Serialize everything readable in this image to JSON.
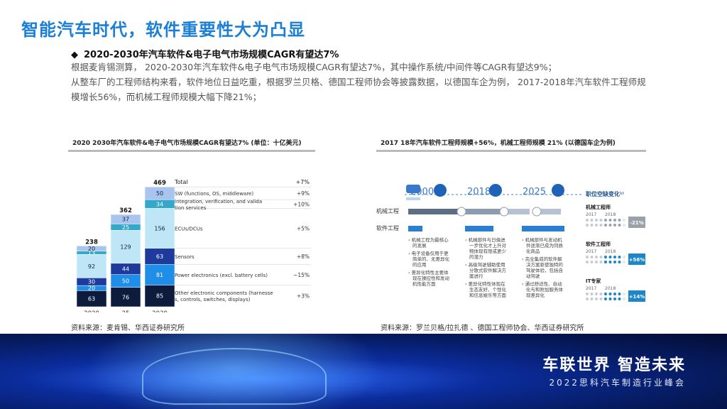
{
  "header": {
    "title": "智能汽车时代，软件重要性大为凸显",
    "bullet": "2020-2030年汽车软件&电子电气市场规模CAGR有望达7%",
    "para1": "根据麦肯锡测算， 2020-2030年汽车软件&电子电气市场规模CAGR有望达7%，其中操作系统/中间件等CAGR有望达9%；",
    "para2": "从整车厂的工程师结构来看，软件地位日益吃重，根据罗兰贝格、德国工程师协会等披露数据，以德国车企为例， 2017-2018年汽车软件工程师规模增长56%，而机械工程师规模大幅下降21%；"
  },
  "left_card": {
    "title": "2020 2030年汽车软件&电子电气市场规模CAGR有望达7% (单位：十亿美元)",
    "source": "资料来源：麦肯锡、华西证券研究所",
    "col_header_total": "Total",
    "col_header_cagr": "+7%"
  },
  "right_card": {
    "title": "2017 18年汽车软件工程师规模+56%，机械工程师规模 21% (以德国车企为例)",
    "source": "资料来源：罗兰贝格/拉扎德 、德国工程师协会、华西证券研究所",
    "years": [
      "2000",
      "2018",
      "2025"
    ],
    "row_mech": "机械工程",
    "row_soft": "软件工程",
    "panel_title": "职位空缺变化¹⁾",
    "groups": [
      {
        "label": "机械工程师",
        "y1": "2017",
        "y2": "2018",
        "change": "-21%",
        "color": "#9aa1ab"
      },
      {
        "label": "软件工程师",
        "y1": "2017",
        "y2": "2018",
        "change": "+56%",
        "color": "#1c86c8"
      },
      {
        "label": "IT专家",
        "y1": "2017",
        "y2": "2018",
        "change": "+14%",
        "color": "#1c86c8"
      }
    ],
    "col_texts": [
      [
        "机械工程为最核心的发展",
        "电子设备仅用于更简单的、无差异化的应用",
        "差异化特性主要体现在操控性和发动机性能方面"
      ],
      [
        "机械部件与日俱进一步优化才上升对物体现有限或更少的潜力",
        "高级驾驶辅助使用分散式软件解决方案进行",
        "差异化特性体现在生态友好、个性化和信息娱乐等方面"
      ],
      [
        "机械部件与发动机件逐渐已成为同质化商品",
        "完全集成的软件解决方案驱使独特的驾驶体验，包括自动驾驶",
        "通过舒适性、自动化与和附加服务体现差异化"
      ]
    ]
  },
  "banner": {
    "slogan": "车联世界 智造未来",
    "subslogan": "2022思科汽车制造行业峰会"
  },
  "chart_data": {
    "type": "bar",
    "title": "2020 2030年汽车软件&电子电气市场规模CAGR有望达7% (单位：十亿美元)",
    "categories": [
      "2020",
      "25",
      "2030"
    ],
    "totals": [
      238,
      362,
      469
    ],
    "series": [
      {
        "name": "Other electronic components (harnesses, controls, switches, displays)",
        "values": [
          63,
          76,
          85
        ],
        "cagr": "+3%",
        "color": "#0d1b3d"
      },
      {
        "name": "Power electronics (excl. battery cells)",
        "values": [
          20,
          50,
          81
        ],
        "cagr": "~15%",
        "color": "#1f8ee8"
      },
      {
        "name": "Sensors",
        "values": [
          30,
          44,
          63
        ],
        "cagr": "+8%",
        "color": "#1e3a9c"
      },
      {
        "name": "ECUs/DCUs",
        "values": [
          92,
          129,
          156
        ],
        "cagr": "+5%",
        "color": "#bfe6f7"
      },
      {
        "name": "Integration, verification, and validation services",
        "values": [
          13,
          25,
          34
        ],
        "cagr": "+10%",
        "color": "#35a8c9"
      },
      {
        "name": "SW (functions, OS, middleware)",
        "values": [
          20,
          37,
          50
        ],
        "cagr": "+9%",
        "color": "#a9c4ef"
      }
    ],
    "legend_total": "Total",
    "legend_total_cagr": "+7%",
    "ylim": [
      0,
      480
    ],
    "source": "资料来源：麦肯锡、华西证券研究所"
  }
}
